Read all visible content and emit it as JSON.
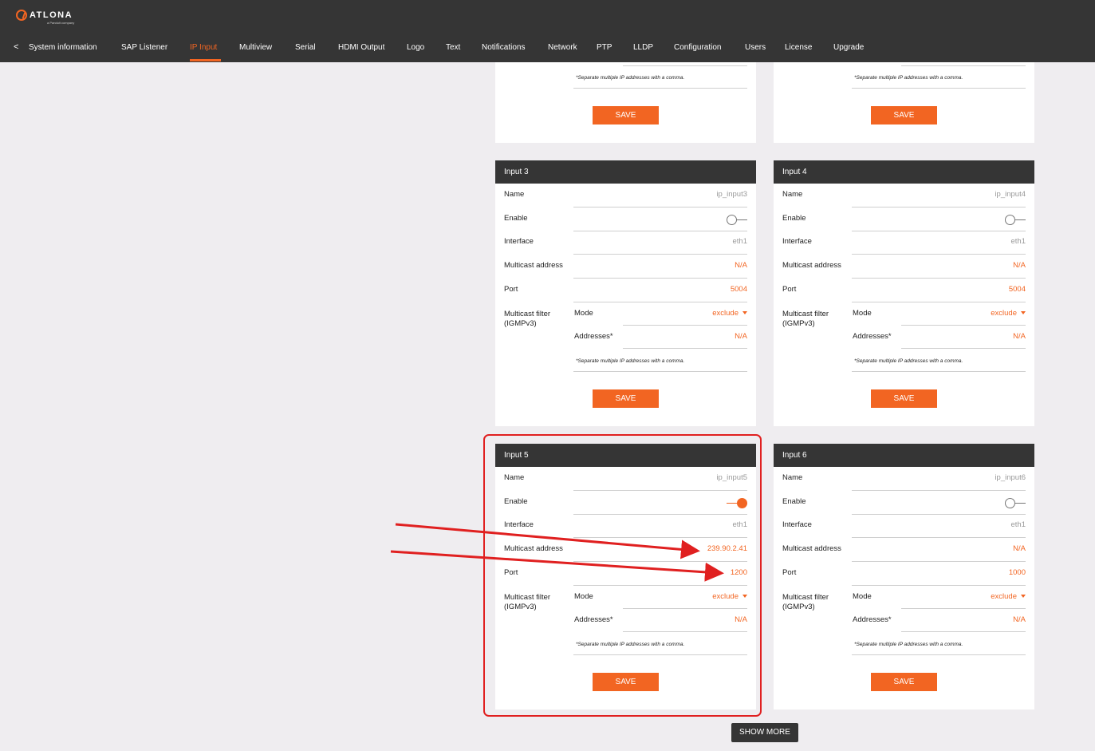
{
  "logo": {
    "text": "ATLONA",
    "sub": "a Panduit company"
  },
  "nav": {
    "back": "<",
    "items": [
      "System information",
      "SAP Listener",
      "IP Input",
      "Multiview",
      "Serial",
      "HDMI Output",
      "Logo",
      "Text",
      "Notifications",
      "Network",
      "PTP",
      "LLDP",
      "Configuration",
      "Users",
      "License",
      "Upgrade"
    ],
    "active": "IP Input"
  },
  "labels": {
    "name": "Name",
    "enable": "Enable",
    "interface": "Interface",
    "multicast_address": "Multicast address",
    "port": "Port",
    "multicast_filter": "Multicast filter (IGMPv3)",
    "mode": "Mode",
    "addresses": "Addresses*",
    "note": "*Separate multiple IP addresses with a comma.",
    "save": "SAVE"
  },
  "inputs": {
    "in1": {
      "note": "*Separate multiple IP addresses with a comma.",
      "save": "SAVE"
    },
    "in2": {
      "note": "*Separate multiple IP addresses with a comma.",
      "save": "SAVE"
    },
    "in3": {
      "title": "Input 3",
      "name": "ip_input3",
      "enabled": false,
      "interface": "eth1",
      "multicast": "N/A",
      "port": "5004",
      "mode": "exclude",
      "addresses": "N/A"
    },
    "in4": {
      "title": "Input 4",
      "name": "ip_input4",
      "enabled": false,
      "interface": "eth1",
      "multicast": "N/A",
      "port": "5004",
      "mode": "exclude",
      "addresses": "N/A"
    },
    "in5": {
      "title": "Input 5",
      "name": "ip_input5",
      "enabled": true,
      "interface": "eth1",
      "multicast": "239.90.2.41",
      "port": "1200",
      "mode": "exclude",
      "addresses": "N/A"
    },
    "in6": {
      "title": "Input 6",
      "name": "ip_input6",
      "enabled": false,
      "interface": "eth1",
      "multicast": "N/A",
      "port": "1000",
      "mode": "exclude",
      "addresses": "N/A"
    }
  },
  "show_more": "SHOW MORE",
  "colors": {
    "accent": "#f26522",
    "header": "#353535",
    "annotation": "#e02020"
  }
}
